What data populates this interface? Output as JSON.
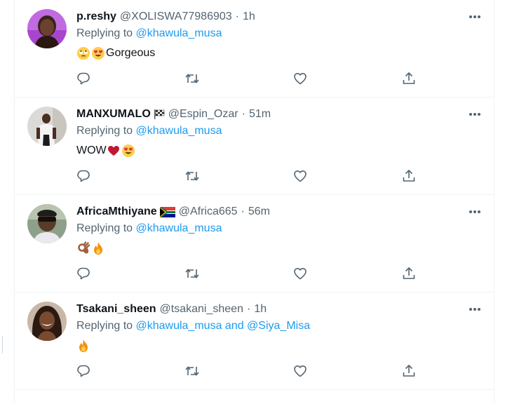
{
  "replies": [
    {
      "name": "p.reshy",
      "name_badge": "",
      "handle": "@XOLISWA77986903",
      "time": "1h",
      "replying_prefix": "Replying to ",
      "replying_to": "@khawula_musa",
      "replying_extra": "",
      "text": "Gorgeous",
      "emojis": [
        "rolling-eyes-emoji",
        "heart-eyes-emoji"
      ],
      "avatar": "avatar-photo-purple"
    },
    {
      "name": "MANXUMALO",
      "name_badge": "checkered-flag-emoji",
      "handle": "@Espin_Ozar",
      "time": "51m",
      "replying_prefix": "Replying to ",
      "replying_to": "@khawula_musa",
      "replying_extra": "",
      "text": "WOW",
      "emojis": [
        "red-heart-emoji",
        "heart-eyes-emoji"
      ],
      "avatar": "avatar-photo-white-shirt"
    },
    {
      "name": "AfricaMthiyane",
      "name_badge": "south-africa-flag-emoji",
      "handle": "@Africa665",
      "time": "56m",
      "replying_prefix": "Replying to ",
      "replying_to": "@khawula_musa",
      "replying_extra": "",
      "text": "",
      "emojis": [
        "ok-hand-emoji",
        "fire-emoji"
      ],
      "avatar": "avatar-photo-sunglasses"
    },
    {
      "name": "Tsakani_sheen",
      "name_badge": "",
      "handle": "@tsakani_sheen",
      "time": "1h",
      "replying_prefix": "Replying to ",
      "replying_to": "@khawula_musa and @Siya_Misa",
      "replying_extra": "",
      "text": "",
      "emojis": [
        "fire-emoji"
      ],
      "avatar": "avatar-photo-smiling"
    }
  ],
  "separator": "·",
  "colors": {
    "link": "#1d9bf0",
    "secondary_text": "#536471",
    "divider": "#eff3f4",
    "primary_text": "#0f1419"
  },
  "icons": {
    "more": "more-horizontal-icon",
    "reply": "reply-icon",
    "retweet": "retweet-icon",
    "like": "like-icon",
    "share": "share-icon"
  }
}
